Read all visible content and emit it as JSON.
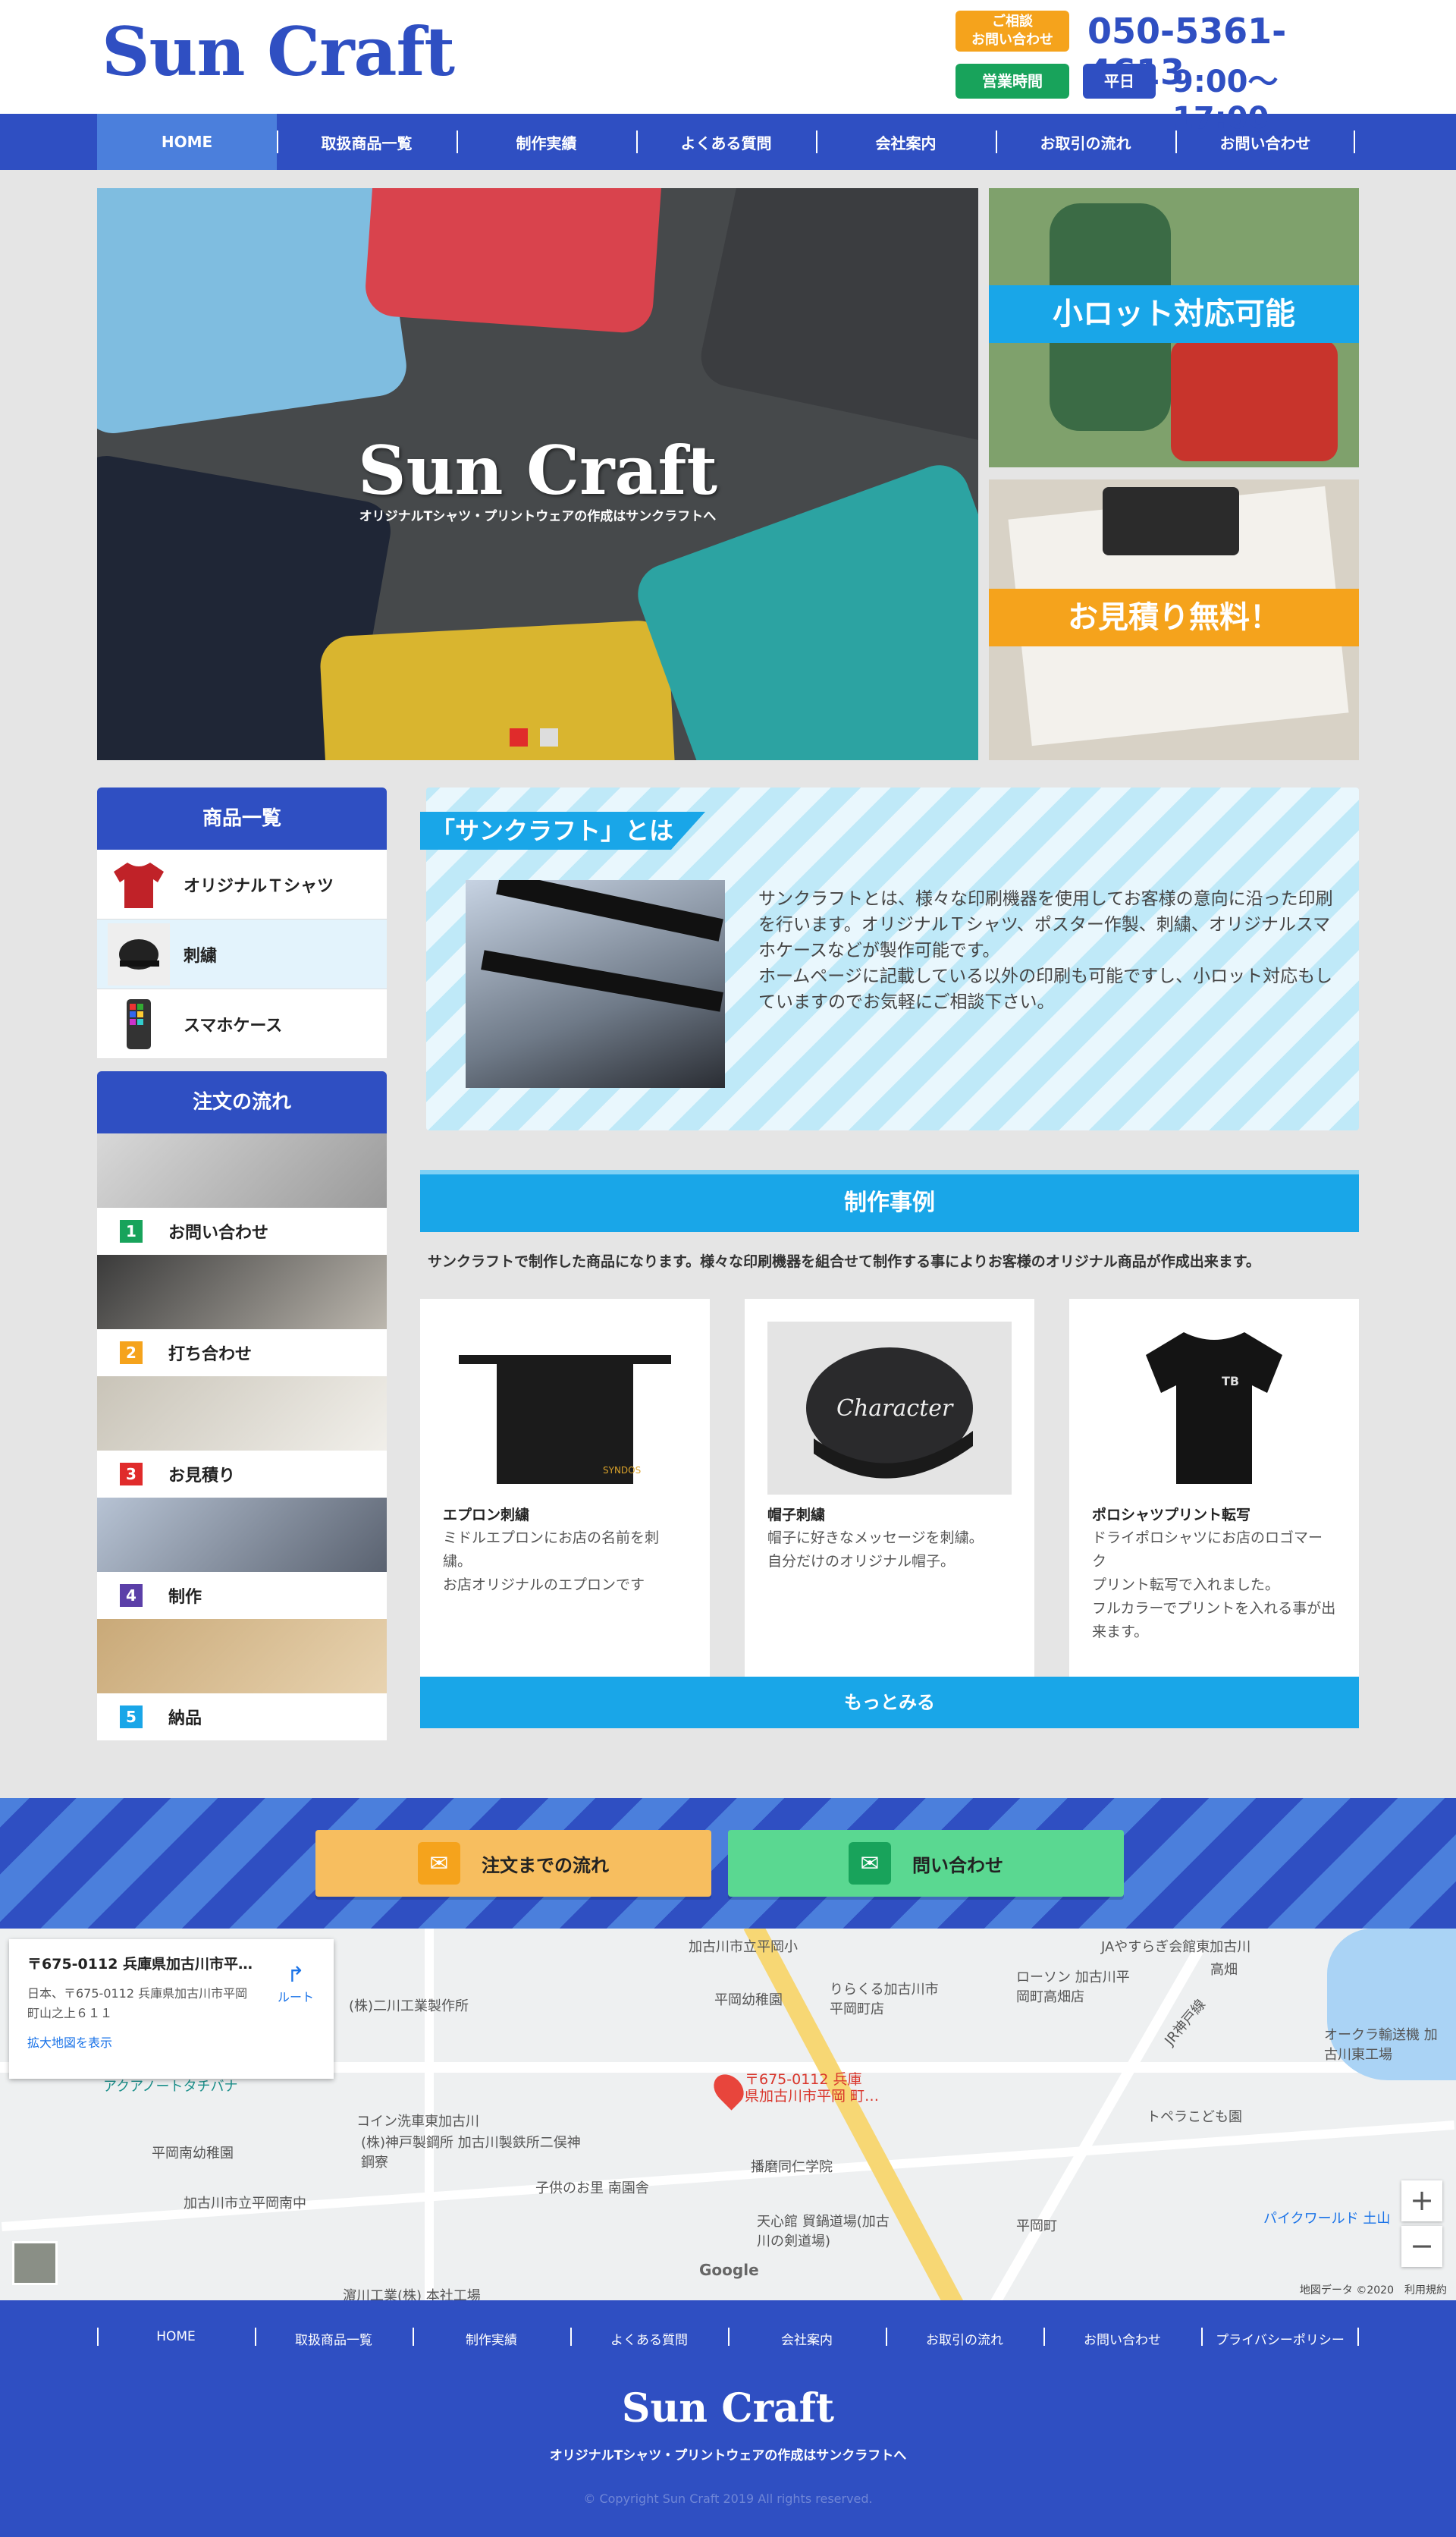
{
  "header": {
    "logo": "Sun Craft",
    "consult_label_1": "ご相談",
    "consult_label_2": "お問い合わせ",
    "phone": "050-5361-4613",
    "hours_label": "営業時間",
    "weekday_label": "平日",
    "hours": "9:00～17:00"
  },
  "nav": [
    "HOME",
    "取扱商品一覧",
    "制作実績",
    "よくある質問",
    "会社案内",
    "お取引の流れ",
    "お問い合わせ"
  ],
  "hero": {
    "title": "Sun Craft",
    "subtitle": "オリジナルTシャツ・プリントウェアの作成はサンクラフトへ"
  },
  "side_banners": [
    "小ロット対応可能",
    "お見積り無料！"
  ],
  "products": {
    "title": "商品一覧",
    "items": [
      "オリジナルＴシャツ",
      "刺繍",
      "スマホケース"
    ]
  },
  "flow": {
    "title": "注文の流れ",
    "steps": [
      {
        "num": "1",
        "label": "お問い合わせ",
        "color": "#18a35b"
      },
      {
        "num": "2",
        "label": "打ち合わせ",
        "color": "#f5a31c"
      },
      {
        "num": "3",
        "label": "お見積り",
        "color": "#e02b2b"
      },
      {
        "num": "4",
        "label": "制作",
        "color": "#5b3fa8"
      },
      {
        "num": "5",
        "label": "納品",
        "color": "#19a6e8"
      }
    ]
  },
  "about": {
    "title": "「サンクラフト」とは",
    "text": "サンクラフトとは、様々な印刷機器を使用してお客様の意向に沿った印刷を行います。オリジナルＴシャツ、ポスター作製、刺繍、オリジナルスマホケースなどが製作可能です。\nホームページに記載している以外の印刷も可能ですし、小ロット対応もしていますのでお気軽にご相談下さい。"
  },
  "works": {
    "title": "制作事例",
    "lead": "サンクラフトで制作した商品になります。様々な印刷機器を組合せて制作する事によりお客様のオリジナル商品が作成出来ます。",
    "cards": [
      {
        "title": "エプロン刺繍",
        "text": "ミドルエプロンにお店の名前を刺繍。\nお店オリジナルのエプロンです",
        "print": "SYNDOS"
      },
      {
        "title": "帽子刺繍",
        "text": "帽子に好きなメッセージを刺繍。\n自分だけのオリジナル帽子。",
        "print": "Character"
      },
      {
        "title": "ポロシャツプリント転写",
        "text": "ドライポロシャツにお店のロゴマーク\nプリント転写で入れました。\nフルカラーでプリントを入れる事が出来ます。",
        "print": "TB"
      }
    ],
    "more": "もっとみる"
  },
  "cta": {
    "order_flow": "注文までの流れ",
    "contact": "問い合わせ"
  },
  "map": {
    "info_title": "〒675-0112 兵庫県加古川市平…",
    "info_address": "日本、〒675-0112 兵庫県加古川市平岡町山之上６１１",
    "info_route": "ルート",
    "info_larger": "拡大地図を表示",
    "pin_label_1": "〒675-0112 兵庫",
    "pin_label_2": "県加古川市平岡 町…",
    "labels": [
      "加古川市立平岡小",
      "JAやすらぎ会館東加古川",
      "(株)二川工業製作所",
      "平岡幼稚園",
      "りらくる加古川市平岡町店",
      "ローソン 加古川平岡町高畑店",
      "JR神戸線",
      "アクアノートタチバナ",
      "コイン洗車東加古川",
      "(株)神戸製鋼所 加古川製鉄所二俣神鋼寮",
      "平岡南幼稚園",
      "播磨同仁学院",
      "子供のお里 南園舎",
      "トペラこども園",
      "加古川市立平岡南中",
      "オークラ輸送機 加古川東工場",
      "天心館 貿鍋道場(加古川の剣道場)",
      "パイクワールド 土山",
      "高畑",
      "平岡町",
      "濵川工業(株) 本社工場"
    ],
    "google": "Google",
    "copyright": "地図データ ©2020　利用規約"
  },
  "footer": {
    "nav": [
      "HOME",
      "取扱商品一覧",
      "制作実績",
      "よくある質問",
      "会社案内",
      "お取引の流れ",
      "お問い合わせ",
      "プライバシーポリシー"
    ],
    "logo": "Sun Craft",
    "subtitle": "オリジナルTシャツ・プリントウェアの作成はサンクラフトへ",
    "copyright": "© Copyright Sun Craft 2019 All rights reserved."
  },
  "colors": {
    "primary": "#2f4fc2",
    "accent": "#19a6e8",
    "orange": "#f5a31c",
    "green": "#18a35b"
  }
}
